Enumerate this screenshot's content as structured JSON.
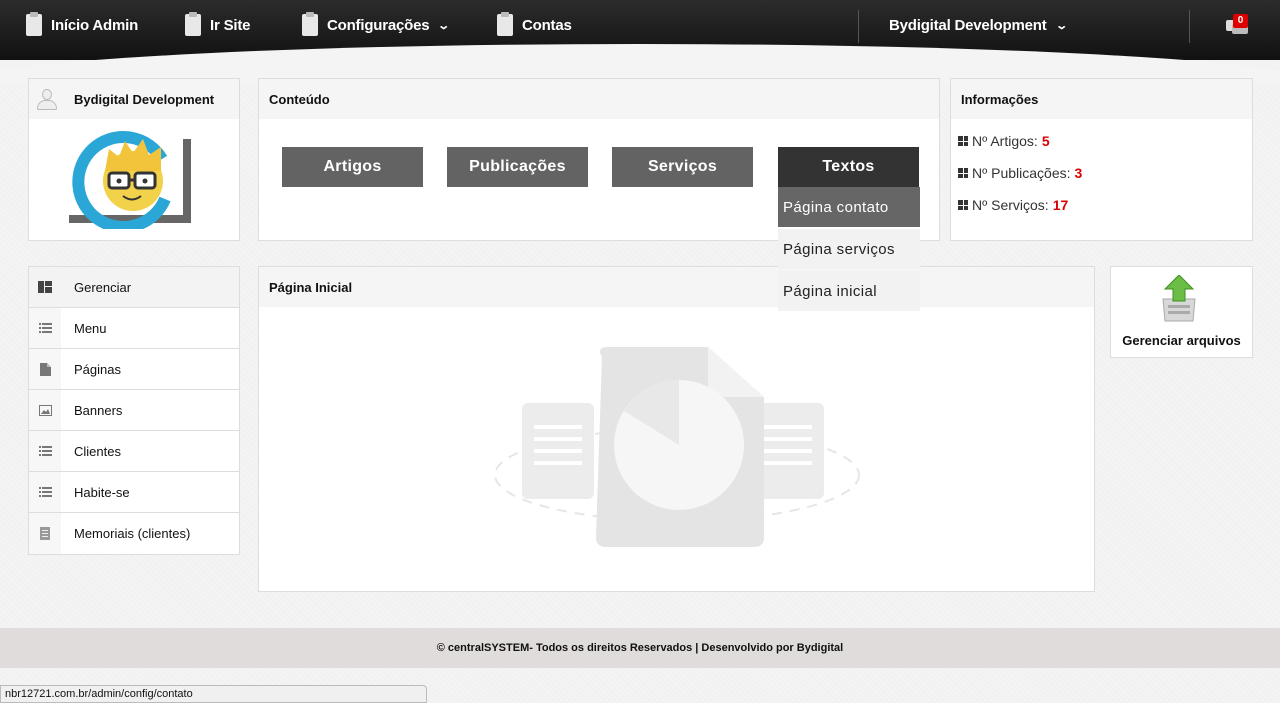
{
  "topbar": {
    "nav": [
      {
        "label": "Início Admin"
      },
      {
        "label": "Ir Site"
      },
      {
        "label": "Configurações"
      },
      {
        "label": "Contas"
      }
    ],
    "account": "Bydigital Development",
    "notification_count": "0"
  },
  "user_panel": {
    "name": "Bydigital Development",
    "avatar_icon": "nerd-face-logo"
  },
  "content_panel": {
    "title": "Conteúdo",
    "buttons": [
      "Artigos",
      "Publicações",
      "Serviços",
      "Textos"
    ],
    "dropdown": [
      "Página contato",
      "Página serviços",
      "Página inicial"
    ]
  },
  "info_panel": {
    "title": "Informações",
    "rows": [
      {
        "label": "Nº Artigos:",
        "value": "5"
      },
      {
        "label": "Nº Publicações:",
        "value": "3"
      },
      {
        "label": "Nº Serviços:",
        "value": "17"
      }
    ]
  },
  "menu": [
    {
      "label": "Gerenciar",
      "icon": "dashboard-icon"
    },
    {
      "label": "Menu",
      "icon": "list-icon"
    },
    {
      "label": "Páginas",
      "icon": "page-icon"
    },
    {
      "label": "Banners",
      "icon": "image-icon"
    },
    {
      "label": "Clientes",
      "icon": "list-icon"
    },
    {
      "label": "Habite-se",
      "icon": "list-icon"
    },
    {
      "label": "Memoriais (clientes)",
      "icon": "document-icon"
    }
  ],
  "home_panel": {
    "title": "Página Inicial",
    "illustration_icon": "pie-chart-document-icon"
  },
  "files_panel": {
    "label": "Gerenciar arquivos",
    "icon": "upload-box-icon"
  },
  "footer": {
    "text": "© centralSYSTEM- Todos os direitos Reservados | Desenvolvido por Bydigital"
  },
  "status_url": "nbr12721.com.br/admin/config/contato",
  "colors": {
    "accent_red": "#dd0000",
    "button_gray": "#636363",
    "button_active": "#333333"
  }
}
